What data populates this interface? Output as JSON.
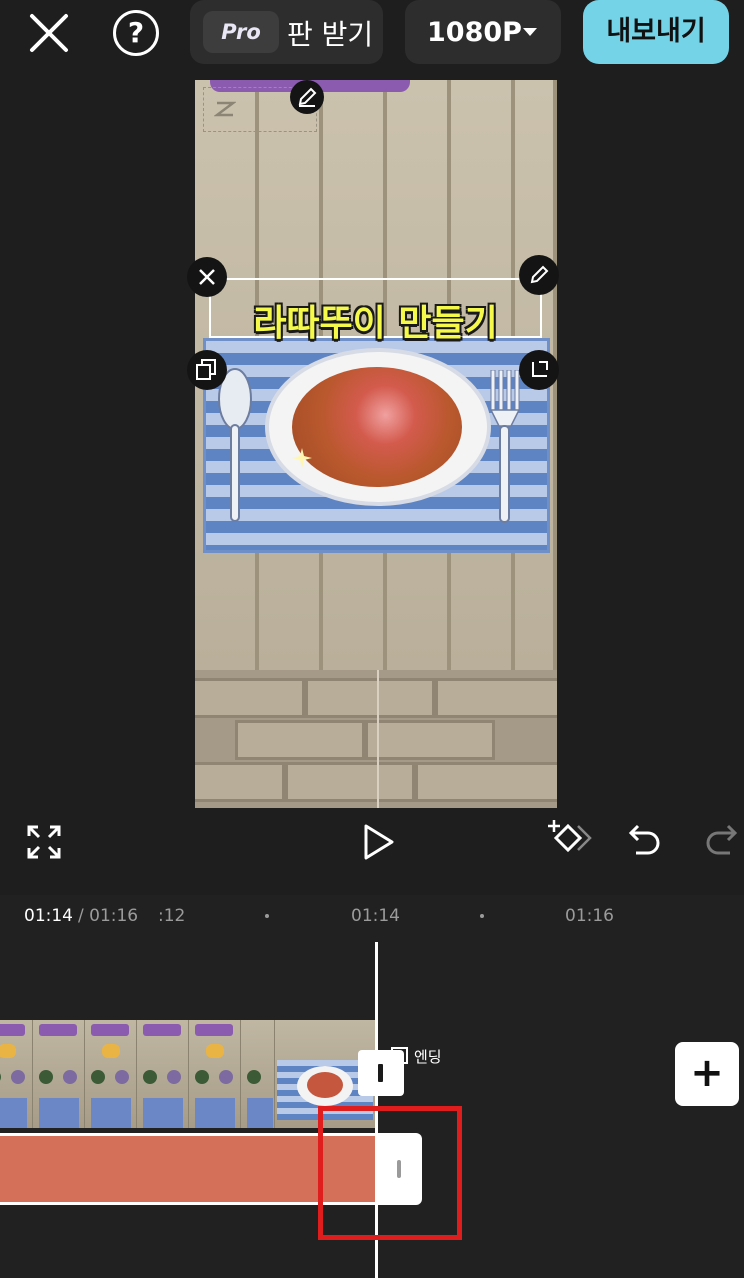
{
  "top_bar": {
    "close_icon": "close-icon",
    "help_symbol": "?",
    "pro_badge": "Pro",
    "pro_text": "판 받기",
    "resolution": "1080P",
    "export_label": "내보내기"
  },
  "preview": {
    "text_overlay": "라따뚜이 만들기"
  },
  "timeline": {
    "current_time": "01:14",
    "total_time": " / 01:16",
    "ticks": [
      ":12",
      "01:14",
      "01:16"
    ],
    "ending_label": "엔딩"
  },
  "colors": {
    "export": "#74d3e7",
    "audio_clip": "#d4705a",
    "highlight": "#e01d1d",
    "title_text": "#f4f94a"
  }
}
